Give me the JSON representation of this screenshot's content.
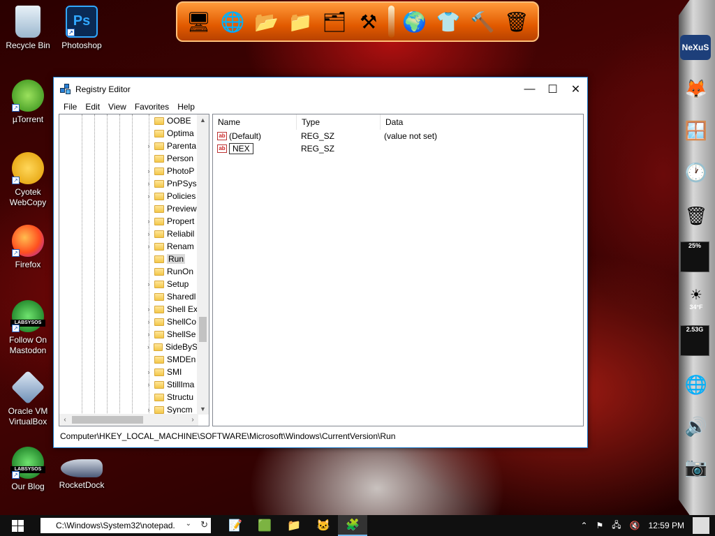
{
  "desktop_icons": [
    {
      "label": "Recycle Bin",
      "icon": "recycle-bin-icon"
    },
    {
      "label": "Photoshop",
      "icon": "photoshop-icon"
    },
    {
      "label": "µTorrent",
      "icon": "utorrent-icon"
    },
    {
      "label": "Cyotek WebCopy",
      "icon": "webcopy-icon"
    },
    {
      "label": "Firefox",
      "icon": "firefox-icon"
    },
    {
      "label": "Follow On Mastodon",
      "icon": "mastodon-icon"
    },
    {
      "label": "Oracle VM VirtualBox",
      "icon": "virtualbox-icon"
    },
    {
      "label": "Our Blog",
      "icon": "blog-icon"
    },
    {
      "label": "RocketDock",
      "icon": "rocketdock-icon"
    }
  ],
  "icon_texts": {
    "photoshop": "Ps",
    "mastodon_badge": "LABSYSOS",
    "blog_badge": "LABSYSOS"
  },
  "sidebar": {
    "brand": "NeXuS",
    "cpu": "25%",
    "weather": "34°F",
    "memory": "2.53G"
  },
  "window": {
    "title": "Registry Editor",
    "menu": [
      "File",
      "Edit",
      "View",
      "Favorites",
      "Help"
    ],
    "tree_items": [
      {
        "label": "OOBE",
        "expand": false
      },
      {
        "label": "Optima",
        "expand": false
      },
      {
        "label": "Parenta",
        "expand": true
      },
      {
        "label": "Person",
        "expand": false
      },
      {
        "label": "PhotoP",
        "expand": true
      },
      {
        "label": "PnPSys",
        "expand": true
      },
      {
        "label": "Policies",
        "expand": true
      },
      {
        "label": "Preview",
        "expand": false
      },
      {
        "label": "Propert",
        "expand": true
      },
      {
        "label": "Reliabil",
        "expand": true
      },
      {
        "label": "Renam",
        "expand": true
      },
      {
        "label": "Run",
        "expand": false,
        "selected": true
      },
      {
        "label": "RunOn",
        "expand": false
      },
      {
        "label": "Setup",
        "expand": true
      },
      {
        "label": "Sharedl",
        "expand": false
      },
      {
        "label": "Shell Ex",
        "expand": true
      },
      {
        "label": "ShellCo",
        "expand": true
      },
      {
        "label": "ShellSe",
        "expand": true
      },
      {
        "label": "SideByS",
        "expand": true
      },
      {
        "label": "SMDEn",
        "expand": false
      },
      {
        "label": "SMI",
        "expand": true
      },
      {
        "label": "StillIma",
        "expand": true
      },
      {
        "label": "Structu",
        "expand": false
      },
      {
        "label": "Syncm",
        "expand": true
      }
    ],
    "columns": {
      "name": "Name",
      "type": "Type",
      "data": "Data"
    },
    "values": [
      {
        "name": "(Default)",
        "type": "REG_SZ",
        "data": "(value not set)",
        "editing": false
      },
      {
        "name": "NEX",
        "type": "REG_SZ",
        "data": "",
        "editing": true
      }
    ],
    "value_icon_text": "ab",
    "status_path": "Computer\\HKEY_LOCAL_MACHINE\\SOFTWARE\\Microsoft\\Windows\\CurrentVersion\\Run"
  },
  "taskbar": {
    "run_value": "C:\\Windows\\System32\\notepad.",
    "time": "12:59 PM"
  }
}
